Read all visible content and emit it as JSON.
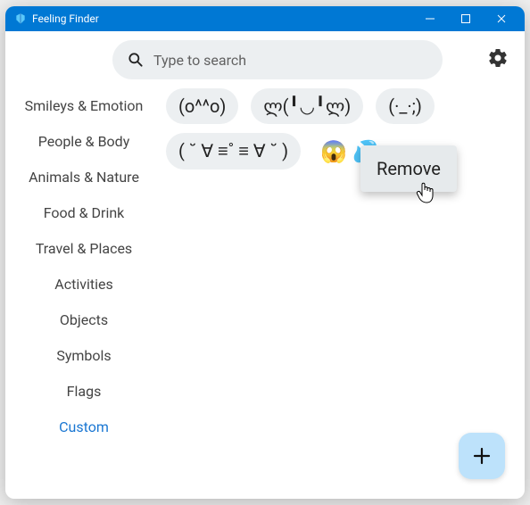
{
  "window": {
    "title": "Feeling Finder"
  },
  "search": {
    "placeholder": "Type to search"
  },
  "sidebar": {
    "items": [
      {
        "label": "Smileys & Emotion",
        "selected": false
      },
      {
        "label": "People & Body",
        "selected": false
      },
      {
        "label": "Animals & Nature",
        "selected": false
      },
      {
        "label": "Food & Drink",
        "selected": false
      },
      {
        "label": "Travel & Places",
        "selected": false
      },
      {
        "label": "Activities",
        "selected": false
      },
      {
        "label": "Objects",
        "selected": false
      },
      {
        "label": "Symbols",
        "selected": false
      },
      {
        "label": "Flags",
        "selected": false
      },
      {
        "label": "Custom",
        "selected": true
      }
    ]
  },
  "emoticons": {
    "row1": [
      "(o^^o)",
      "ლ(╹◡╹ლ)",
      "(·_·;)"
    ],
    "row2": [
      "( ˘ ∀ ≡˚ ≡ ∀ ˘ )",
      "😱 💦"
    ]
  },
  "context_menu": {
    "remove_label": "Remove"
  },
  "colors": {
    "titlebar": "#0078d4",
    "accent": "#1976d2",
    "chip_bg": "#eceff1",
    "fab_bg": "#bde2fb"
  }
}
